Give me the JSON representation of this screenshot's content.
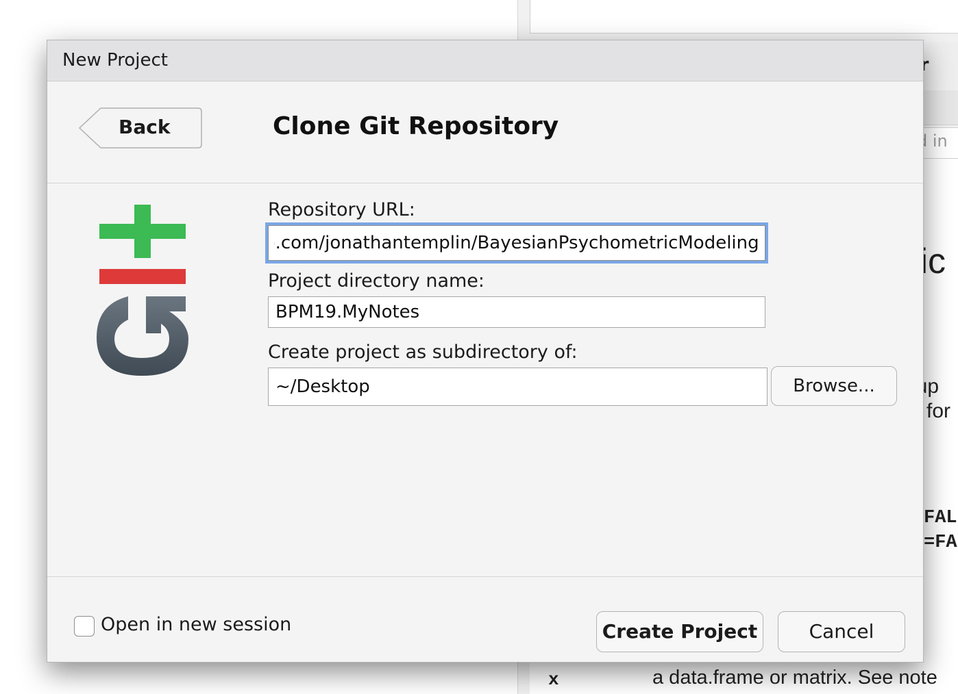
{
  "background": {
    "tab_partial": "er",
    "search_partial": "d in",
    "heading_partial": "tic",
    "text_line_1": "oup",
    "text_line_2": "for",
    "code_line_1": "FAL",
    "code_line_2": "=FA",
    "arg_name": "x",
    "arg_description": "a data.frame or matrix. See note"
  },
  "dialog": {
    "title": "New Project",
    "back_label": "Back",
    "page_title": "Clone Git Repository",
    "logo_icon": "git-logo-icon",
    "repo_url_label": "Repository URL:",
    "repo_url_value": "https://github.com/jonathantemplin/BayesianPsychometricModeling",
    "project_dir_label": "Project directory name:",
    "project_dir_value": "BPM19.MyNotes",
    "subdir_label": "Create project as subdirectory of:",
    "subdir_value": "~/Desktop",
    "browse_label": "Browse...",
    "open_new_session_label": "Open in new session",
    "open_new_session_checked": false,
    "create_label": "Create Project",
    "cancel_label": "Cancel"
  },
  "colors": {
    "focus_ring": "#7aa6e6",
    "git_green": "#3cba54",
    "git_red": "#de3a3a",
    "git_gray": "#4c5863"
  }
}
